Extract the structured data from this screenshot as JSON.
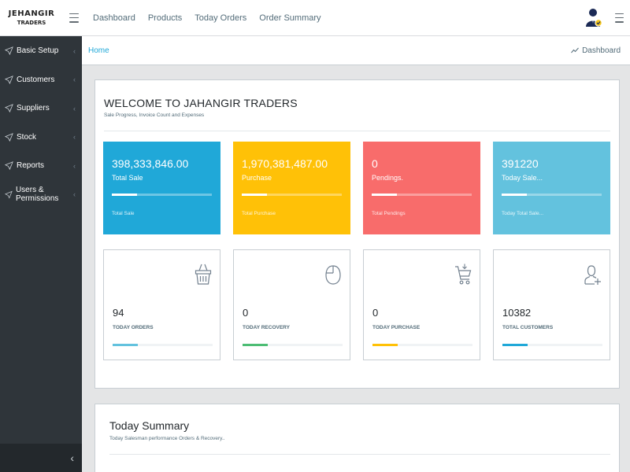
{
  "logo": {
    "line1": "JEHANGIR",
    "line2": "TRADERS"
  },
  "topnav": [
    {
      "label": "Dashboard"
    },
    {
      "label": "Products"
    },
    {
      "label": "Today Orders"
    },
    {
      "label": "Order Summary"
    }
  ],
  "sidebar": {
    "items": [
      {
        "label": "Basic Setup"
      },
      {
        "label": "Customers"
      },
      {
        "label": "Suppliers"
      },
      {
        "label": "Stock"
      },
      {
        "label": "Reports"
      },
      {
        "label": "Users & Permissions"
      }
    ],
    "collapse_glyph": "‹"
  },
  "breadcrumb": {
    "home": "Home",
    "current": "Dashboard"
  },
  "welcome": {
    "title": "WELCOME TO JAHANGIR TRADERS",
    "subtitle": "Sale Progress, Invoice Count and Expenses"
  },
  "stats": [
    {
      "value": "398,333,846.00",
      "label": "Total Sale",
      "footer": "Total Sale",
      "color": "#20a8d8",
      "progress": 0.25
    },
    {
      "value": "1,970,381,487.00",
      "label": "Purchase",
      "footer": "Total Purchase",
      "color": "#ffc107",
      "progress": 0.25
    },
    {
      "value": "0",
      "label": "Pendings.",
      "footer": "Total Pendings",
      "color": "#f86c6b",
      "progress": 0.25
    },
    {
      "value": "391220",
      "label": "Today Sale...",
      "footer": "Today Total Sale...",
      "color": "#63c2de",
      "progress": 0.25
    }
  ],
  "widgets": [
    {
      "value": "94",
      "label": "TODAY ORDERS",
      "icon": "basket-icon",
      "color": "#63c2de",
      "progress": 0.25
    },
    {
      "value": "0",
      "label": "TODAY RECOVERY",
      "icon": "mouse-icon",
      "color": "#4dbd74",
      "progress": 0.25
    },
    {
      "value": "0",
      "label": "TODAY PURCHASE",
      "icon": "cart-icon",
      "color": "#ffc107",
      "progress": 0.25
    },
    {
      "value": "10382",
      "label": "TOTAL CUSTOMERS",
      "icon": "user-add-icon",
      "color": "#20a8d8",
      "progress": 0.25
    }
  ],
  "summary": {
    "title": "Today Summary",
    "subtitle": "Today Salesman performance Orders & Recovery.."
  }
}
